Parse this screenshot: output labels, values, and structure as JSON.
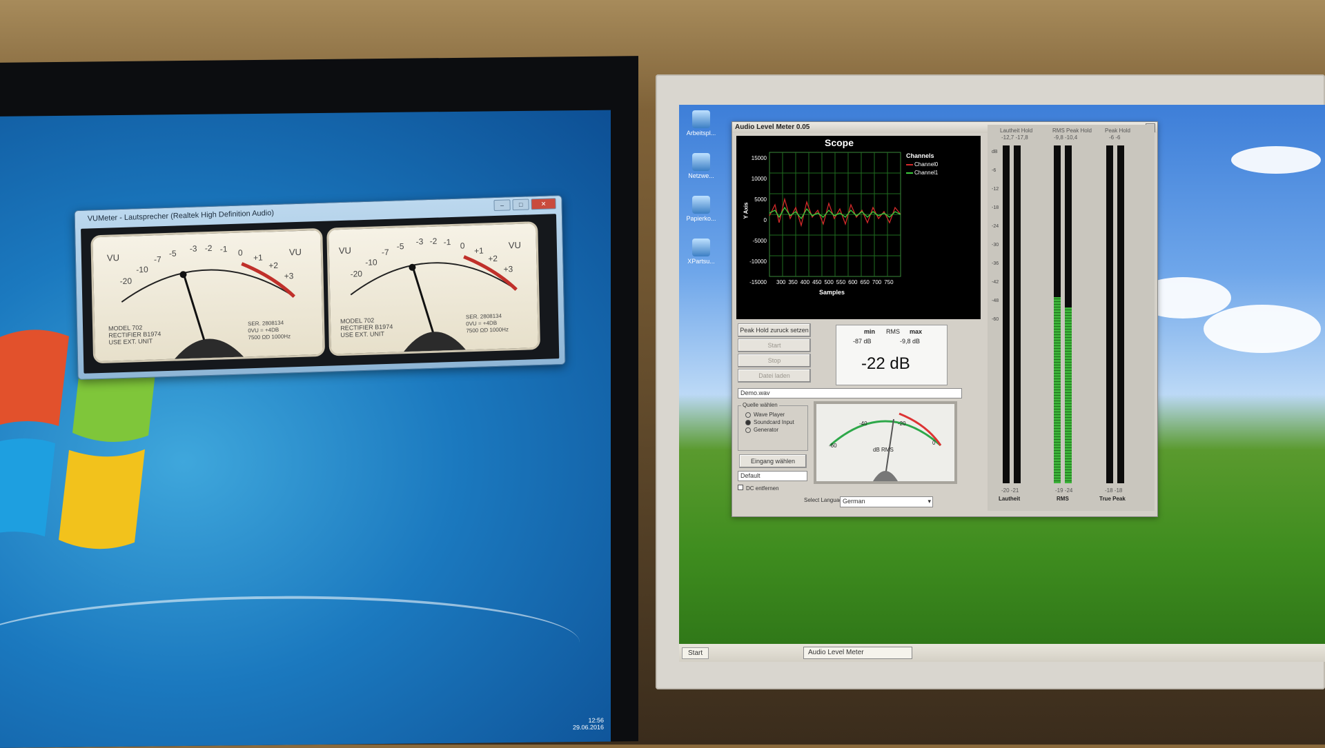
{
  "left_monitor": {
    "vu_window": {
      "title": "VUMeter - Lautsprecher (Realtek High Definition Audio)",
      "buttons": [
        "–",
        "□",
        "✕"
      ],
      "meters": [
        {
          "scale_labels": [
            "VU",
            "-20",
            "-10",
            "-7",
            "-5",
            "-3",
            "-2",
            "-1",
            "0",
            "+1",
            "+2",
            "+3",
            "VU"
          ],
          "model_text": "MODEL 702\nRECTIFIER B1974\nUSE EXT. UNIT",
          "serial_text": "SER. 2808134\n0VU = +4DB\n7500 ΩD 1000Hz"
        },
        {
          "scale_labels": [
            "VU",
            "-20",
            "-10",
            "-7",
            "-5",
            "-3",
            "-2",
            "-1",
            "0",
            "+1",
            "+2",
            "+3",
            "VU"
          ],
          "model_text": "MODEL 702\nRECTIFIER B1974\nUSE EXT. UNIT",
          "serial_text": "SER. 2808134\n0VU = +4DB\n7500 ΩD 1000Hz"
        }
      ]
    },
    "taskbar_time": "12:56",
    "taskbar_date": "29.06.2016"
  },
  "right_monitor": {
    "desktop_icons": [
      "Arbeitspl...",
      "Netzwe...",
      "Papierko...",
      "XPartsu..."
    ],
    "taskbar": {
      "start": "Start",
      "task": "Audio Level Meter"
    },
    "app": {
      "title": "Audio Level Meter 0.05",
      "close": "x",
      "scope": {
        "title": "Scope",
        "legend_title": "Channels",
        "y_axis_label": "Y Axis",
        "x_axis_label": "Samples",
        "y_ticks": [
          "15000",
          "10000",
          "5000",
          "0",
          "-5000",
          "-10000",
          "-15000"
        ],
        "x_ticks": [
          "300",
          "350",
          "400",
          "450",
          "500",
          "550",
          "600",
          "650",
          "700",
          "750"
        ]
      },
      "buttons": {
        "peak_hold_reset": "Peak Hold zuruck setzen",
        "start": "Start",
        "stop": "Stop",
        "load": "Datei laden",
        "select_input": "Eingang wählen"
      },
      "rms_box": {
        "min_label": "min",
        "rms_label": "RMS",
        "max_label": "max",
        "min_value": "-87 dB",
        "max_value": "-9,8 dB",
        "rms_value": "-22 dB"
      },
      "file_field": "Demo.wav",
      "source_group": {
        "title": "Quelle wählen",
        "options": [
          "Wave Player",
          "Soundcard Input",
          "Generator"
        ],
        "selected": "Soundcard Input"
      },
      "device_field": "Default",
      "dc_checkbox": "DC entfernen",
      "dial": {
        "labels": [
          "-60",
          "-40",
          "-20",
          "0"
        ],
        "unit": "dB RMS"
      },
      "language_label": "Select Language",
      "language_value": "German",
      "level_meters": {
        "headers": [
          {
            "title": "Lautheit Hold",
            "values": "-12,7  -17,8"
          },
          {
            "title": "RMS Peak Hold",
            "values": "-9,8  -10,4"
          },
          {
            "title": "Peak Hold",
            "values": "-6  -6"
          }
        ],
        "scale": [
          "dB",
          "-6",
          "-12",
          "-18",
          "-24",
          "-30",
          "-36",
          "-42",
          "-48",
          "-60"
        ],
        "footer_values": [
          {
            "values": "-20   -21",
            "label": "Lautheit"
          },
          {
            "values": "-19   -24",
            "label": "RMS"
          },
          {
            "values": "-18   -18",
            "label": "True Peak"
          }
        ],
        "fill_levels": [
          0.0,
          0.0,
          0.55,
          0.52,
          0.0,
          0.0
        ]
      }
    }
  }
}
